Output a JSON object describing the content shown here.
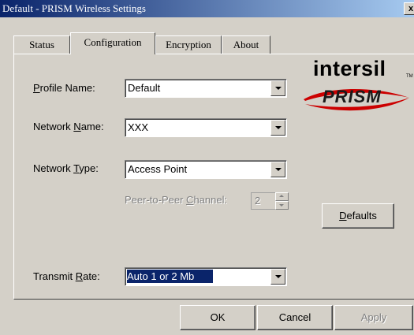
{
  "window": {
    "title": "Default - PRISM Wireless Settings",
    "close_label": "x"
  },
  "tabs": [
    {
      "label": "Status"
    },
    {
      "label": "Configuration",
      "active": true
    },
    {
      "label": "Encryption"
    },
    {
      "label": "About"
    }
  ],
  "logo": {
    "company": "intersil",
    "trademark": "TM",
    "product": "PRISM",
    "accent_color": "#cc0000"
  },
  "form": {
    "profile_name": {
      "label_prefix": "",
      "label_mnemonic": "P",
      "label_suffix": "rofile Name:",
      "value": "Default"
    },
    "network_name": {
      "label_prefix": "Network ",
      "label_mnemonic": "N",
      "label_suffix": "ame:",
      "value": "XXX"
    },
    "network_type": {
      "label_prefix": "Network ",
      "label_mnemonic": "T",
      "label_suffix": "ype:",
      "value": "Access Point"
    },
    "channel": {
      "label_prefix": "Peer-to-Peer ",
      "label_mnemonic": "C",
      "label_suffix": "hannel:",
      "value": "2"
    },
    "transmit_rate": {
      "label_prefix": "Transmit ",
      "label_mnemonic": "R",
      "label_suffix": "ate:",
      "value": "Auto 1 or 2 Mb"
    }
  },
  "buttons": {
    "defaults": {
      "mnemonic": "D",
      "rest": "efaults"
    },
    "ok": "OK",
    "cancel": "Cancel",
    "apply": "Apply"
  }
}
